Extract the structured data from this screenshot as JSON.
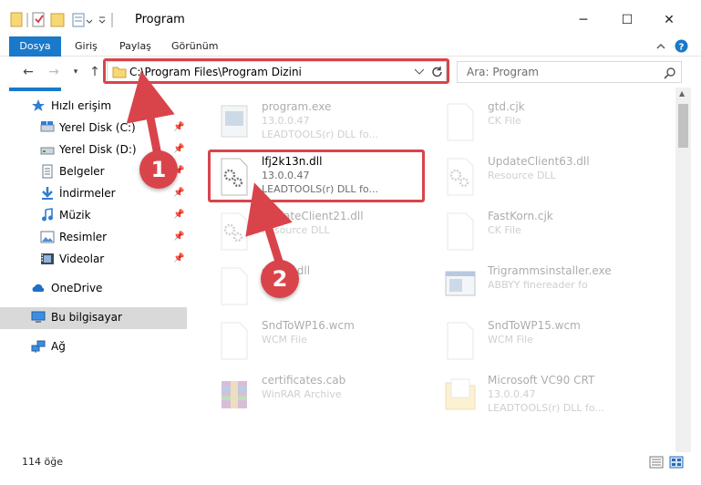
{
  "window": {
    "title": "Program",
    "minimize": "─",
    "maximize": "☐",
    "close": "✕"
  },
  "ribbon": {
    "tabs": [
      "Dosya",
      "Giriş",
      "Paylaş",
      "Görünüm"
    ]
  },
  "address": {
    "path": "C:\\Program Files\\Program Dizini",
    "search_placeholder": "Ara: Program"
  },
  "sidebar": {
    "quick_access": "Hızlı erişim",
    "items": [
      {
        "label": "Yerel Disk (C:)",
        "icon": "drive-icon"
      },
      {
        "label": "Yerel Disk (D:)",
        "icon": "drive-icon"
      },
      {
        "label": "Belgeler",
        "icon": "documents-icon"
      },
      {
        "label": "İndirmeler",
        "icon": "downloads-icon"
      },
      {
        "label": "Müzik",
        "icon": "music-icon"
      },
      {
        "label": "Resimler",
        "icon": "pictures-icon"
      },
      {
        "label": "Videolar",
        "icon": "videos-icon"
      }
    ],
    "onedrive": "OneDrive",
    "this_pc": "Bu bilgisayar",
    "network": "Ağ"
  },
  "files": {
    "left": [
      {
        "name": "program.exe",
        "line2": "13.0.0.47",
        "line3": "LEADTOOLS(r) DLL fo..."
      },
      {
        "name": "lfj2k13n.dll",
        "line2": "13.0.0.47",
        "line3": "LEADTOOLS(r) DLL fo..."
      },
      {
        "name": "UpdateClient21.dll",
        "line2": "Resource DLL",
        "line3": ""
      },
      {
        "name": "gtmpf.dll",
        "line2": "",
        "line3": ""
      },
      {
        "name": "SndToWP16.wcm",
        "line2": "WCM File",
        "line3": ""
      },
      {
        "name": "certificates.cab",
        "line2": "WinRAR Archive",
        "line3": ""
      }
    ],
    "right": [
      {
        "name": "gtd.cjk",
        "line2": "CK File",
        "line3": ""
      },
      {
        "name": "UpdateClient63.dll",
        "line2": "Resource DLL",
        "line3": ""
      },
      {
        "name": "FastKorn.cjk",
        "line2": "CK File",
        "line3": ""
      },
      {
        "name": "Trigrammsinstaller.exe",
        "line2": "ABBYY finereader fo",
        "line3": ""
      },
      {
        "name": "SndToWP15.wcm",
        "line2": "WCM File",
        "line3": ""
      },
      {
        "name": "Microsoft VC90 CRT",
        "line2": "13.0.0.47",
        "line3": "LEADTOOLS(r) DLL fo..."
      }
    ]
  },
  "callouts": [
    "1",
    "2"
  ],
  "status": {
    "count": "114 öğe"
  },
  "colors": {
    "accent": "#1979ca",
    "highlight": "#d9444b"
  }
}
